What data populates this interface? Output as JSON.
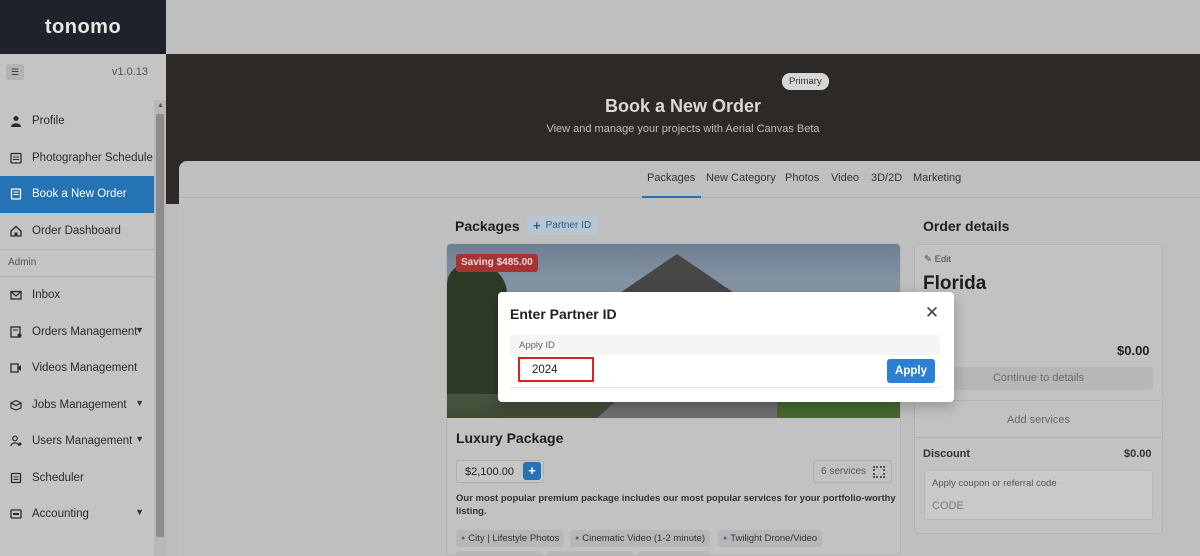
{
  "app": {
    "logo": "tonomo",
    "version": "v1.0.13"
  },
  "sidebar": {
    "items": [
      {
        "label": "Profile",
        "icon": "person-icon"
      },
      {
        "label": "Photographer Schedule",
        "icon": "calendar-icon"
      },
      {
        "label": "Book a New Order",
        "icon": "book-icon",
        "active": true
      },
      {
        "label": "Order Dashboard",
        "icon": "home-icon"
      }
    ],
    "admin_section": "Admin",
    "admin_items": [
      {
        "label": "Inbox",
        "icon": "mail-icon"
      },
      {
        "label": "Orders Management",
        "icon": "orders-icon",
        "expandable": true
      },
      {
        "label": "Videos Management",
        "icon": "video-icon"
      },
      {
        "label": "Jobs Management",
        "icon": "jobs-icon",
        "expandable": true
      },
      {
        "label": "Users Management",
        "icon": "users-icon",
        "expandable": true
      },
      {
        "label": "Scheduler",
        "icon": "scheduler-icon"
      },
      {
        "label": "Accounting",
        "icon": "accounting-icon",
        "expandable": true
      }
    ]
  },
  "hero": {
    "badge": "Primary",
    "title": "Book a New Order",
    "subtitle": "View and manage your projects with Aerial Canvas Beta"
  },
  "tabs": [
    "Packages",
    "New Category",
    "Photos",
    "Video",
    "3D/2D",
    "Marketing"
  ],
  "packages": {
    "heading": "Packages",
    "partner_button": "Partner ID",
    "card": {
      "saving": "Saving $485.00",
      "title": "Luxury Package",
      "price": "$2,100.00",
      "services": "6 services",
      "description": "Our most popular premium package includes our most popular services for your portfolio-worthy listing.",
      "features": [
        "City | Lifestyle Photos",
        "Cinematic Video (1-2 minute)",
        "Twilight Drone/Video"
      ]
    }
  },
  "order_details": {
    "heading": "Order details",
    "edit": "Edit",
    "location": "Florida",
    "total_label": ":",
    "total": "$0.00",
    "continue": "Continue to details",
    "add_services": "Add services",
    "discount_label": "Discount",
    "discount_value": "$0.00",
    "coupon_label": "Apply coupon or referral code",
    "coupon_placeholder": "CODE"
  },
  "modal": {
    "title": "Enter Partner ID",
    "field_label": "Apply ID",
    "field_value": "2024",
    "apply_button": "Apply"
  },
  "colors": {
    "accent": "#2572b5",
    "sidebar_dark": "#1f222a",
    "hero_bg": "#2d2926",
    "highlight_border": "#e0201c",
    "saving_badge": "#a63434"
  }
}
